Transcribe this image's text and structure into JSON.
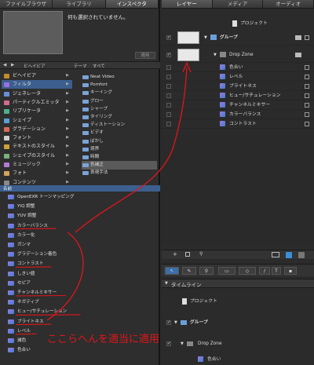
{
  "left_tabs": [
    "ファイルブラウザ",
    "ライブラリ",
    "インスペクタ"
  ],
  "preview": {
    "no_selection": "何も選択されていません。",
    "apply": "適用"
  },
  "navbar": {
    "left_label": "ビヘイビア",
    "search_label": "テーマ",
    "all_label": "すべて"
  },
  "categories": [
    {
      "label": "ビヘイビア",
      "color": "#c58a2b"
    },
    {
      "label": "フィルタ",
      "color": "#9b6fe0",
      "selected": true
    },
    {
      "label": "ジェネレータ",
      "color": "#6a8fd8"
    },
    {
      "label": "パーティクルエミッタ",
      "color": "#d06c8f"
    },
    {
      "label": "リプリケータ",
      "color": "#4db08a"
    },
    {
      "label": "シェイプ",
      "color": "#5aa0d6"
    },
    {
      "label": "グラデーション",
      "color": "#d86a5a"
    },
    {
      "label": "フォント",
      "color": "#cfcfcf"
    },
    {
      "label": "テキストのスタイル",
      "color": "#d0a03a"
    },
    {
      "label": "シェイプのスタイル",
      "color": "#7ab07a"
    },
    {
      "label": "ミュージック",
      "color": "#b37ad6"
    },
    {
      "label": "フォト",
      "color": "#d6a35a"
    },
    {
      "label": "コンテンツ",
      "color": "#8a8a8a"
    }
  ],
  "subfolders": [
    "Neat Video",
    "Pomfort",
    "キーイング",
    "グロー",
    "シャープ",
    "タイリング",
    "ディストーション",
    "ビデオ",
    "ぼかし",
    "境界",
    "時間",
    "色補正",
    "表現手法"
  ],
  "filter_header": "名前",
  "filters": [
    "OpenEXR トーンマッピング",
    "YIQ 調整",
    "YUV 調整",
    "カラーバランス",
    "カラー化",
    "ガンマ",
    "グラデーション着色",
    "コントラスト",
    "しきい値",
    "セピア",
    "チャンネルミキサー",
    "ネガティブ",
    "ヒュー/サチュレーション",
    "ブライトネス",
    "レベル",
    "減色",
    "色合い"
  ],
  "right_tabs": [
    "レイヤー",
    "メディア",
    "オーディオ"
  ],
  "layers": {
    "project": "プロジェクト",
    "group": "グループ",
    "dropzone": "Drop Zone",
    "filters": [
      "色合い",
      "レベル",
      "ブライトネス",
      "ヒュー/サチュレーション",
      "チャンネルミキサー",
      "カラーバランス",
      "コントラスト"
    ]
  },
  "timeline": {
    "title": "タイムライン",
    "project": "プロジェクト",
    "group": "グループ",
    "dropzone": "Drop Zone",
    "filter": "色合い"
  },
  "annotation": {
    "text": "ここらへんを適当に適用",
    "color": "#e0161a"
  }
}
